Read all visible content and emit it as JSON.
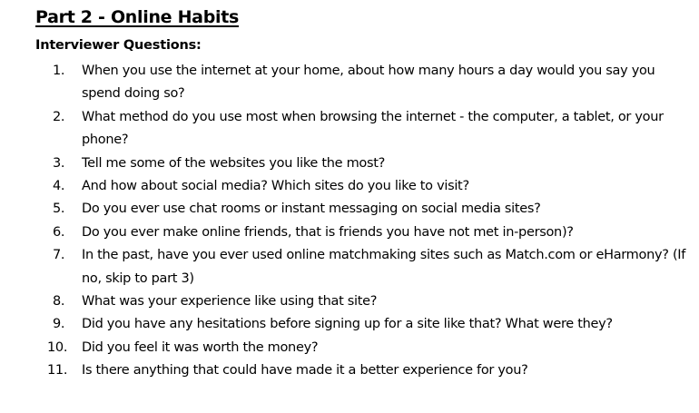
{
  "heading": "Part 2 - Online Habits",
  "subheading": "Interviewer Questions:",
  "questions": [
    {
      "num": "1.",
      "text": "When you use the internet at your home, about how many hours a day would you say you spend doing so?"
    },
    {
      "num": "2.",
      "text": "What method do you use most when browsing the internet - the computer, a tablet, or your phone?"
    },
    {
      "num": "3.",
      "text": "Tell me some of the websites you like the most?"
    },
    {
      "num": "4.",
      "text": "And how about social media? Which sites do you like to visit?"
    },
    {
      "num": "5.",
      "text": "Do you ever use chat rooms or instant messaging on social media sites?"
    },
    {
      "num": "6.",
      "text": "Do you ever make online friends, that is friends you have not met in-person)?"
    },
    {
      "num": "7.",
      "text": "In the past, have you ever used online matchmaking sites such as Match.com or eHarmony? (If no, skip to part 3)"
    },
    {
      "num": "8.",
      "text": "What was your experience like using that site?"
    },
    {
      "num": "9.",
      "text": "Did you have any hesitations before signing up for a site like that?  What were they?"
    },
    {
      "num": "10.",
      "text": "Did you feel it was worth the money?"
    },
    {
      "num": "11.",
      "text": "Is there anything that could have made it a better experience for you?"
    }
  ]
}
